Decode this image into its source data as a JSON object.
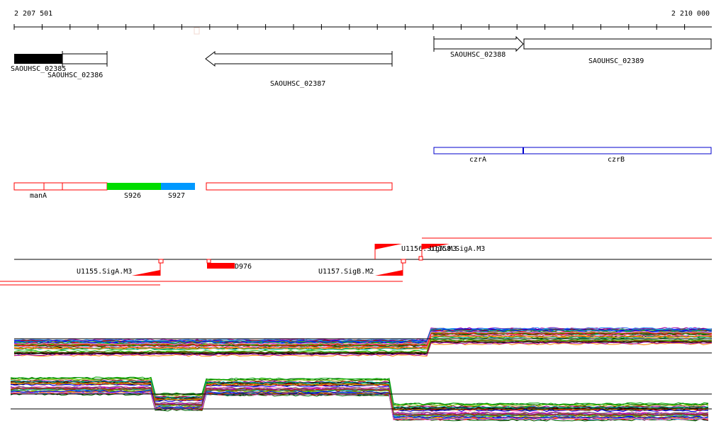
{
  "ruler": {
    "start_label": "2 207 501",
    "end_label": "2 210 000"
  },
  "genes": [
    {
      "name": "SAOUHSC_02385",
      "strand": "-",
      "filled": true
    },
    {
      "name": "SAOUHSC_02386",
      "strand": "-",
      "filled": false
    },
    {
      "name": "SAOUHSC_02387",
      "strand": "-",
      "filled": false
    },
    {
      "name": "SAOUHSC_02388",
      "strand": "+",
      "filled": false
    },
    {
      "name": "SAOUHSC_02389",
      "strand": "+",
      "filled": false
    }
  ],
  "operon_genes": [
    {
      "name": "czrA"
    },
    {
      "name": "czrB"
    }
  ],
  "annotations": [
    {
      "name": "manA",
      "color": "#ff0000"
    },
    {
      "name": "S926",
      "color": "#00dd00"
    },
    {
      "name": "S927",
      "color": "#0099ff"
    }
  ],
  "promoters": [
    {
      "name": "U1155.SigA.M3"
    },
    {
      "name": "D976"
    },
    {
      "name": "U1157.SigB.M2"
    },
    {
      "name": "U1156.SigA.M3"
    },
    {
      "name": "U1158.SigA.M3"
    }
  ],
  "colors": {
    "gene_outline": "#000000",
    "operon": "#0000cc",
    "promoter": "#ff0000"
  },
  "expression": {
    "series_colors": [
      "#000000",
      "#ff0000",
      "#00aa00",
      "#0000ff",
      "#ff8800",
      "#aa00aa",
      "#00aaaa",
      "#888800",
      "#884400",
      "#ff66cc",
      "#66cc00",
      "#3399ff",
      "#990000",
      "#006600",
      "#666666"
    ],
    "top_track_levels": [
      0.62,
      0.62,
      0.3
    ],
    "bottom_track_levels": [
      0.25,
      0.55,
      0.2,
      0.05,
      0.9
    ]
  }
}
